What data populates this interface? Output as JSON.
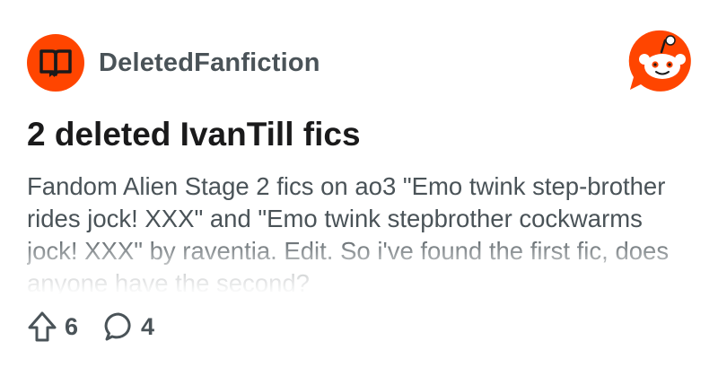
{
  "subreddit": {
    "name": "DeletedFanfiction",
    "icon": "open-book-icon",
    "avatar_color": "#ff4500"
  },
  "brand": {
    "logo": "reddit-snoo-icon",
    "color": "#ff4500"
  },
  "post": {
    "title": "2 deleted IvanTill fics",
    "body": "Fandom Alien Stage 2 fics on ao3 \"Emo twink step-brother rides jock! XXX\" and \"Emo twink stepbrother cockwarms jock! XXX\" by raventia. Edit. So i've found the first fic, does anyone have the second?"
  },
  "actions": {
    "upvote_icon": "upvote-arrow-icon",
    "upvotes": "6",
    "comment_icon": "comment-bubble-icon",
    "comments": "4"
  }
}
